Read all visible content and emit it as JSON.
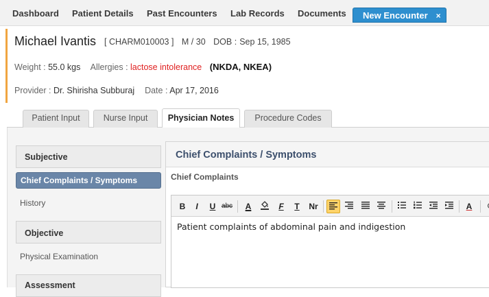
{
  "nav": {
    "tabs": [
      "Dashboard",
      "Patient Details",
      "Past Encounters",
      "Lab Records",
      "Documents"
    ],
    "active_tab": "New Encounter",
    "close_glyph": "×"
  },
  "patient": {
    "name": "Michael Ivantis",
    "id": "[ CHARM010003 ]",
    "gender_age": "M / 30",
    "dob_label": "DOB :",
    "dob": "Sep 15, 1985",
    "weight_label": "Weight :",
    "weight": "55.0 kgs",
    "allergies_label": "Allergies :",
    "allergies": "lactose intolerance",
    "nk": "(NKDA, NKEA)",
    "provider_label": "Provider :",
    "provider": "Dr. Shirisha Subburaj",
    "date_label": "Date :",
    "date": "Apr 17, 2016"
  },
  "subtabs": [
    "Patient Input",
    "Nurse Input",
    "Physician Notes",
    "Procedure Codes"
  ],
  "active_subtab": "Physician Notes",
  "leftnav": {
    "subjective": "Subjective",
    "chief": "Chief Complaints / Symptoms",
    "history": "History",
    "objective": "Objective",
    "physical": "Physical Examination",
    "assessment": "Assessment"
  },
  "main": {
    "title": "Chief Complaints / Symptoms",
    "label": "Chief Complaints",
    "text": "Patient complaints of abdominal pain and indigestion"
  },
  "toolbar": {
    "bold": "B",
    "italic": "I",
    "underline": "U",
    "strike": "abc",
    "textcolor": "A",
    "fontfamily": "F",
    "fontsize": "T",
    "normal": "Nr",
    "spellcheck": "A"
  }
}
